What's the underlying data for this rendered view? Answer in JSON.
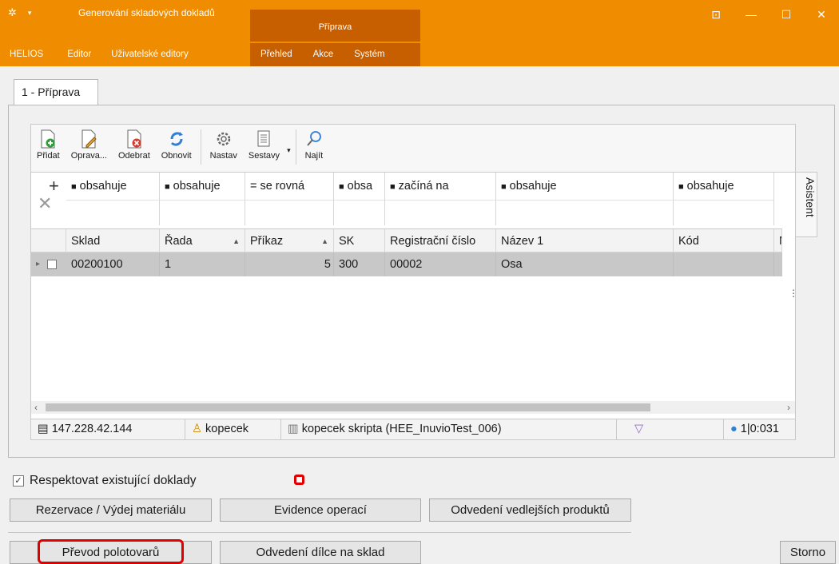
{
  "window": {
    "title": "Generování skladových dokladů",
    "context_tab": "Příprava",
    "controls": [
      "⊡",
      "—",
      "☐",
      "✕"
    ]
  },
  "menu": {
    "left": [
      "HELIOS",
      "Editor",
      "Uživatelské editory"
    ],
    "context": [
      "Přehled",
      "Akce",
      "Systém"
    ]
  },
  "doc_tab": "1 - Příprava",
  "toolbar": {
    "add": "Přidat",
    "edit": "Oprava...",
    "remove": "Odebrat",
    "refresh": "Obnovit",
    "settings": "Nastav",
    "reports": "Sestavy",
    "find": "Najít"
  },
  "filters": [
    "obsahuje",
    "obsahuje",
    "se rovná",
    "obsa",
    "začíná na",
    "obsahuje",
    "obsahuje"
  ],
  "filter_symbols": [
    "■",
    "■",
    "=",
    "■",
    "■",
    "■",
    "■"
  ],
  "columns": [
    "Sklad",
    "Řada",
    "Příkaz",
    "SK",
    "Registrační číslo",
    "Název 1",
    "Kód",
    "N"
  ],
  "rows": [
    {
      "sklad": "00200100",
      "rada": "1",
      "prikaz": "5",
      "sk": "300",
      "reg": "00002",
      "nazev": "Osa",
      "kod": ""
    }
  ],
  "asistent": "Asistent",
  "status": {
    "ip": "147.228.42.144",
    "user": "kopecek",
    "db": "kopecek skripta (HEE_InuvioTest_006)",
    "counter": "1|0:031"
  },
  "bottom": {
    "respect_checkbox": "Respektovat existující doklady",
    "rezervace": "Rezervace / Výdej materiálu",
    "evidence": "Evidence operací",
    "odvedeni_vedl": "Odvedení vedlejších produktů",
    "prevod": "Převod polotovarů",
    "odvedeni_dilce": "Odvedení dílce na sklad",
    "storno": "Storno"
  }
}
